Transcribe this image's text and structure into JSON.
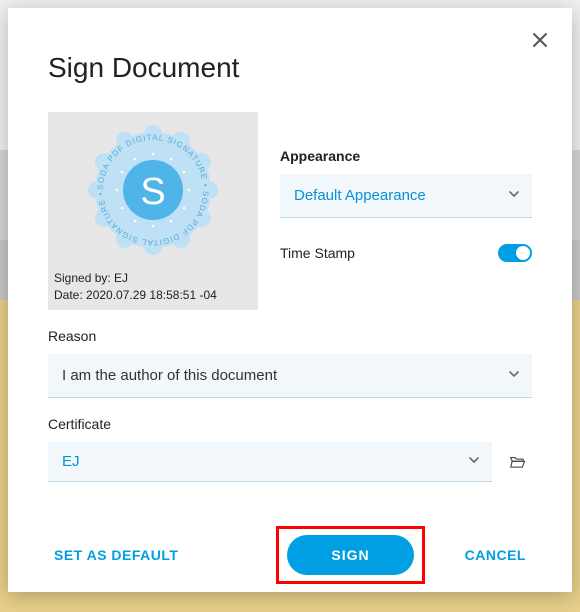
{
  "dialog": {
    "title": "Sign Document"
  },
  "preview": {
    "seal_text": "SODA PDF DIGITAL SIGNATURE • SODA PDF DIGITAL SIGNATURE • ",
    "seal_initial": "S",
    "signed_by_line": "Signed by: EJ",
    "date_line": "Date: 2020.07.29 18:58:51 -04"
  },
  "fields": {
    "appearance": {
      "label": "Appearance",
      "value": "Default Appearance"
    },
    "timestamp": {
      "label": "Time Stamp",
      "on": true
    },
    "reason": {
      "label": "Reason",
      "value": "I am the author of this document"
    },
    "certificate": {
      "label": "Certificate",
      "value": "EJ"
    }
  },
  "actions": {
    "set_default": "SET AS DEFAULT",
    "sign": "SIGN",
    "cancel": "CANCEL"
  }
}
